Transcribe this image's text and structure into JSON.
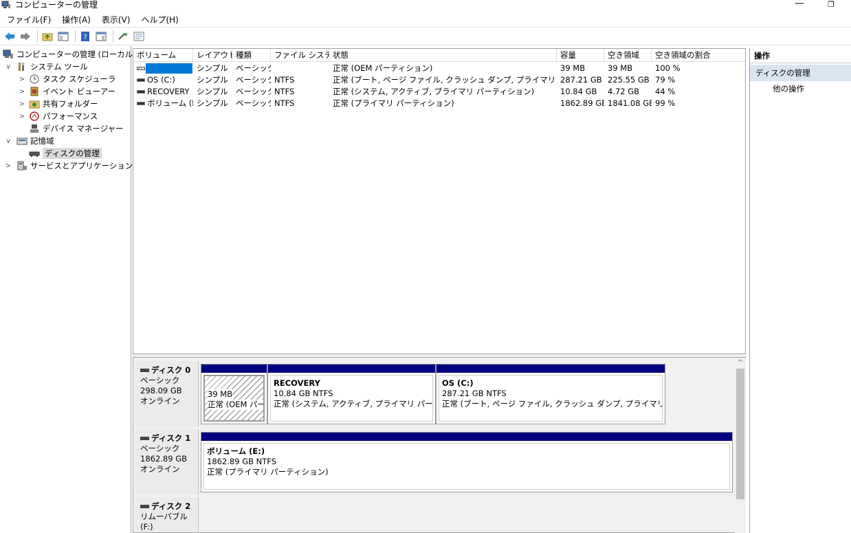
{
  "window": {
    "title": "コンピューターの管理",
    "minimize": "—",
    "restore": "❐"
  },
  "menu": [
    "ファイル(F)",
    "操作(A)",
    "表示(V)",
    "ヘルプ(H)"
  ],
  "tree": [
    {
      "label": "コンピューターの管理 (ローカル)",
      "chev": "",
      "indent": 0,
      "icon": "computer-management-icon"
    },
    {
      "label": "システム ツール",
      "chev": "∨",
      "indent": 1,
      "icon": "system-tools-icon"
    },
    {
      "label": "タスク スケジューラ",
      "chev": ">",
      "indent": 2,
      "icon": "task-scheduler-icon"
    },
    {
      "label": "イベント ビューアー",
      "chev": ">",
      "indent": 2,
      "icon": "event-viewer-icon"
    },
    {
      "label": "共有フォルダー",
      "chev": ">",
      "indent": 2,
      "icon": "shared-folders-icon"
    },
    {
      "label": "パフォーマンス",
      "chev": ">",
      "indent": 2,
      "icon": "performance-icon"
    },
    {
      "label": "デバイス マネージャー",
      "chev": "",
      "indent": 2,
      "icon": "device-manager-icon"
    },
    {
      "label": "記憶域",
      "chev": "∨",
      "indent": 1,
      "icon": "storage-icon"
    },
    {
      "label": "ディスクの管理",
      "chev": "",
      "indent": 2,
      "icon": "disk-management-icon",
      "selected": true
    },
    {
      "label": "サービスとアプリケーション",
      "chev": ">",
      "indent": 1,
      "icon": "services-apps-icon"
    }
  ],
  "columns": [
    "ボリューム",
    "レイアウト",
    "種類",
    "ファイル システム",
    "状態",
    "容量",
    "空き領域",
    "空き領域の割合"
  ],
  "volumes": [
    {
      "volume": "",
      "layout": "シンプル",
      "type": "ベーシック",
      "fs": "",
      "status": "正常 (OEM パーティション)",
      "capacity": "39 MB",
      "free": "39 MB",
      "pct": "100 %"
    },
    {
      "volume": "OS (C:)",
      "layout": "シンプル",
      "type": "ベーシック",
      "fs": "NTFS",
      "status": "正常 (ブート, ページ ファイル, クラッシュ ダンプ, プライマリ パーティション)",
      "capacity": "287.21 GB",
      "free": "225.55 GB",
      "pct": "79 %"
    },
    {
      "volume": "RECOVERY",
      "layout": "シンプル",
      "type": "ベーシック",
      "fs": "NTFS",
      "status": "正常 (システム, アクティブ, プライマリ パーティション)",
      "capacity": "10.84 GB",
      "free": "4.72 GB",
      "pct": "44 %"
    },
    {
      "volume": "ボリューム (E:)",
      "layout": "シンプル",
      "type": "ベーシック",
      "fs": "NTFS",
      "status": "正常 (プライマリ パーティション)",
      "capacity": "1862.89 GB",
      "free": "1841.08 GB",
      "pct": "99 %"
    }
  ],
  "disks": [
    {
      "name": "ディスク 0",
      "type": "ベーシック",
      "size": "298.09 GB",
      "state": "オンライン",
      "partitions": [
        {
          "name": "",
          "size": "39 MB",
          "status": "正常 (OEM パーティション)"
        },
        {
          "name": "RECOVERY",
          "size": "10.84 GB NTFS",
          "status": "正常 (システム, アクティブ, プライマリ パーティション)"
        },
        {
          "name": "OS  (C:)",
          "size": "287.21 GB NTFS",
          "status": "正常 (ブート, ページ ファイル, クラッシュ ダンプ, プライマリ パーティション)"
        }
      ]
    },
    {
      "name": "ディスク 1",
      "type": "ベーシック",
      "size": "1862.89 GB",
      "state": "オンライン",
      "partitions": [
        {
          "name": "ボリューム  (E:)",
          "size": "1862.89 GB NTFS",
          "status": "正常 (プライマリ パーティション)"
        }
      ]
    },
    {
      "name": "ディスク 2",
      "type": "リムーバブル (F:)",
      "size": "",
      "state": "",
      "partitions": []
    }
  ],
  "actions": {
    "header": "操作",
    "section": "ディスクの管理",
    "item": "他の操作"
  },
  "scroll_up": "^"
}
